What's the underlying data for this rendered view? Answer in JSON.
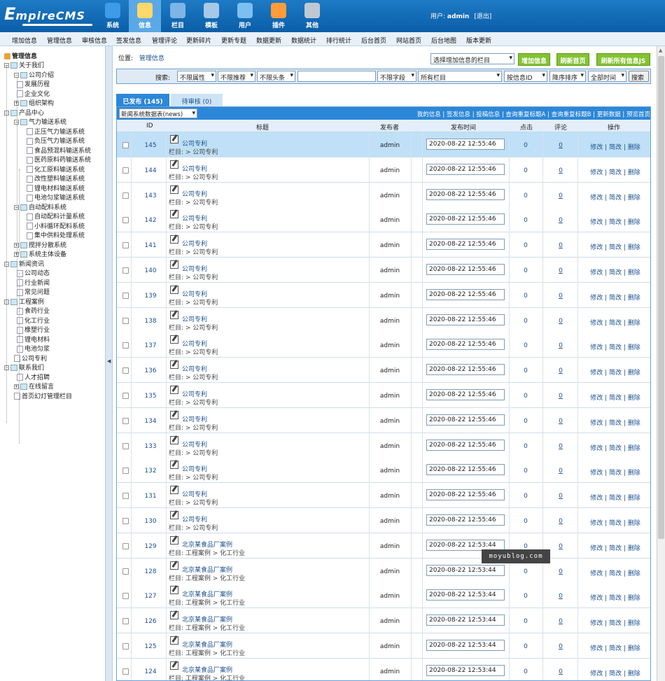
{
  "logo": {
    "first": "E",
    "rest": "mpireCMS"
  },
  "topnav": [
    {
      "label": "系统",
      "icon": "globe-icon"
    },
    {
      "label": "信息",
      "icon": "edit-icon"
    },
    {
      "label": "栏目",
      "icon": "folder-icon"
    },
    {
      "label": "模板",
      "icon": "template-icon"
    },
    {
      "label": "用户",
      "icon": "user-icon"
    },
    {
      "label": "插件",
      "icon": "tools-icon"
    },
    {
      "label": "其他",
      "icon": "gear-icon"
    }
  ],
  "user": {
    "prefix": "用户:",
    "name": "admin",
    "logout": "[退出]"
  },
  "menubar": [
    "增加信息",
    "管理信息",
    "审核信息",
    "签发信息",
    "管理评论",
    "更新碎片",
    "更新专题",
    "数据更新",
    "数据统计",
    "排行统计",
    "后台首页",
    "网站首页",
    "后台地图",
    "版本更新"
  ],
  "sidebar": {
    "title": "管理信息",
    "items": [
      {
        "label": "关于我们",
        "type": "folder",
        "level": 1
      },
      {
        "label": "公司介绍",
        "type": "folder",
        "level": 2
      },
      {
        "label": "发展历程",
        "type": "doc",
        "level": 3
      },
      {
        "label": "企业文化",
        "type": "doc",
        "level": 3
      },
      {
        "label": "组织架构",
        "type": "folder",
        "level": 2
      },
      {
        "label": "产品中心",
        "type": "folder",
        "level": 1
      },
      {
        "label": "气力输送系统",
        "type": "folder",
        "level": 2
      },
      {
        "label": "正压气力输送系统",
        "type": "doc",
        "level": 4
      },
      {
        "label": "负压气力输送系统",
        "type": "doc",
        "level": 4
      },
      {
        "label": "食品预混料输送系统",
        "type": "doc",
        "level": 4
      },
      {
        "label": "医药原料药输送系统",
        "type": "doc",
        "level": 4
      },
      {
        "label": "化工原料输送系统",
        "type": "doc",
        "level": 4
      },
      {
        "label": "改性塑料输送系统",
        "type": "doc",
        "level": 4
      },
      {
        "label": "锂电材料输送系统",
        "type": "doc",
        "level": 4
      },
      {
        "label": "电池匀浆输送系统",
        "type": "doc",
        "level": 4
      },
      {
        "label": "自动配料系统",
        "type": "folder",
        "level": 2
      },
      {
        "label": "自动配料计量系统",
        "type": "doc",
        "level": 4
      },
      {
        "label": "小料循环配料系统",
        "type": "doc",
        "level": 4
      },
      {
        "label": "集中供料处理系统",
        "type": "doc",
        "level": 4
      },
      {
        "label": "搅拌分散系统",
        "type": "folder",
        "level": 2
      },
      {
        "label": "系统主体设备",
        "type": "folder",
        "level": 2
      },
      {
        "label": "新闻资讯",
        "type": "folder",
        "level": 1
      },
      {
        "label": "公司动态",
        "type": "doc",
        "level": 3
      },
      {
        "label": "行业新闻",
        "type": "doc",
        "level": 3
      },
      {
        "label": "常见问题",
        "type": "doc",
        "level": 3
      },
      {
        "label": "工程案例",
        "type": "folder",
        "level": 1
      },
      {
        "label": "食药行业",
        "type": "doc",
        "level": 3
      },
      {
        "label": "化工行业",
        "type": "doc",
        "level": 3
      },
      {
        "label": "橡塑行业",
        "type": "doc",
        "level": 3
      },
      {
        "label": "锂电材料",
        "type": "doc",
        "level": 3
      },
      {
        "label": "电池匀浆",
        "type": "doc",
        "level": 3
      },
      {
        "label": "公司专利",
        "type": "doc",
        "level": 2
      },
      {
        "label": "联系我们",
        "type": "folder",
        "level": 1
      },
      {
        "label": "人才招聘",
        "type": "doc",
        "level": 3
      },
      {
        "label": "在线留言",
        "type": "folder",
        "level": 2
      },
      {
        "label": "首页幻灯管理栏目",
        "type": "doc",
        "level": 2
      }
    ]
  },
  "posbar": {
    "label": "位置:",
    "link": "管理信息"
  },
  "column_select": "选择增加信息的栏目",
  "buttons": {
    "add": "增加信息",
    "refresh": "刷新首页",
    "refresh_js": "刷新所有信息JS"
  },
  "search": {
    "label": "搜索:",
    "attr": "不限属性",
    "recommend": "不限推荐",
    "headline": "不限头条",
    "field": "不限字段",
    "column": "所有栏目",
    "order_by": "按信息ID",
    "order": "降序排序",
    "time": "全部时间",
    "submit": "搜索"
  },
  "tabs": {
    "published": "已发布 (145)",
    "pending": "待审核 (0)"
  },
  "table_module": "新闻系统数据表(news)",
  "header_links": "我的信息 | 签发信息 | 投稿信息 | 查询重复标题A | 查询重复标题B | 更新数据 | 预览首页",
  "columns": {
    "id": "ID",
    "title": "标题",
    "publisher": "发布者",
    "time": "发布时间",
    "clicks": "点击",
    "comments": "评论",
    "ops": "操作"
  },
  "rows": [
    {
      "id": "145",
      "title": "公司专利",
      "column": "栏目: > 公司专利",
      "publisher": "admin",
      "time": "2020-08-22 12:55:46",
      "clicks": "0",
      "comments": "0",
      "ops": "修改 | 简改 | 删除"
    },
    {
      "id": "144",
      "title": "公司专利",
      "column": "栏目: > 公司专利",
      "publisher": "admin",
      "time": "2020-08-22 12:55:46",
      "clicks": "0",
      "comments": "0",
      "ops": "修改 | 简改 | 删除"
    },
    {
      "id": "143",
      "title": "公司专利",
      "column": "栏目: > 公司专利",
      "publisher": "admin",
      "time": "2020-08-22 12:55:46",
      "clicks": "0",
      "comments": "0",
      "ops": "修改 | 简改 | 删除"
    },
    {
      "id": "142",
      "title": "公司专利",
      "column": "栏目: > 公司专利",
      "publisher": "admin",
      "time": "2020-08-22 12:55:46",
      "clicks": "0",
      "comments": "0",
      "ops": "修改 | 简改 | 删除"
    },
    {
      "id": "141",
      "title": "公司专利",
      "column": "栏目: > 公司专利",
      "publisher": "admin",
      "time": "2020-08-22 12:55:46",
      "clicks": "0",
      "comments": "0",
      "ops": "修改 | 简改 | 删除"
    },
    {
      "id": "140",
      "title": "公司专利",
      "column": "栏目: > 公司专利",
      "publisher": "admin",
      "time": "2020-08-22 12:55:46",
      "clicks": "0",
      "comments": "0",
      "ops": "修改 | 简改 | 删除"
    },
    {
      "id": "139",
      "title": "公司专利",
      "column": "栏目: > 公司专利",
      "publisher": "admin",
      "time": "2020-08-22 12:55:46",
      "clicks": "0",
      "comments": "0",
      "ops": "修改 | 简改 | 删除"
    },
    {
      "id": "138",
      "title": "公司专利",
      "column": "栏目: > 公司专利",
      "publisher": "admin",
      "time": "2020-08-22 12:55:46",
      "clicks": "0",
      "comments": "0",
      "ops": "修改 | 简改 | 删除"
    },
    {
      "id": "137",
      "title": "公司专利",
      "column": "栏目: > 公司专利",
      "publisher": "admin",
      "time": "2020-08-22 12:55:46",
      "clicks": "0",
      "comments": "0",
      "ops": "修改 | 简改 | 删除"
    },
    {
      "id": "136",
      "title": "公司专利",
      "column": "栏目: > 公司专利",
      "publisher": "admin",
      "time": "2020-08-22 12:55:46",
      "clicks": "0",
      "comments": "0",
      "ops": "修改 | 简改 | 删除"
    },
    {
      "id": "135",
      "title": "公司专利",
      "column": "栏目: > 公司专利",
      "publisher": "admin",
      "time": "2020-08-22 12:55:46",
      "clicks": "0",
      "comments": "0",
      "ops": "修改 | 简改 | 删除"
    },
    {
      "id": "134",
      "title": "公司专利",
      "column": "栏目: > 公司专利",
      "publisher": "admin",
      "time": "2020-08-22 12:55:46",
      "clicks": "0",
      "comments": "0",
      "ops": "修改 | 简改 | 删除"
    },
    {
      "id": "133",
      "title": "公司专利",
      "column": "栏目: > 公司专利",
      "publisher": "admin",
      "time": "2020-08-22 12:55:46",
      "clicks": "0",
      "comments": "0",
      "ops": "修改 | 简改 | 删除"
    },
    {
      "id": "132",
      "title": "公司专利",
      "column": "栏目: > 公司专利",
      "publisher": "admin",
      "time": "2020-08-22 12:55:46",
      "clicks": "0",
      "comments": "0",
      "ops": "修改 | 简改 | 删除"
    },
    {
      "id": "131",
      "title": "公司专利",
      "column": "栏目: > 公司专利",
      "publisher": "admin",
      "time": "2020-08-22 12:55:46",
      "clicks": "0",
      "comments": "0",
      "ops": "修改 | 简改 | 删除"
    },
    {
      "id": "130",
      "title": "公司专利",
      "column": "栏目: > 公司专利",
      "publisher": "admin",
      "time": "2020-08-22 12:55:46",
      "clicks": "0",
      "comments": "0",
      "ops": "修改 | 简改 | 删除"
    },
    {
      "id": "129",
      "title": "北京某食品厂案例",
      "column": "栏目: 工程案例 > 化工行业",
      "publisher": "admin",
      "time": "2020-08-22 12:53:44",
      "clicks": "0",
      "comments": "0",
      "ops": "修改 | 简改 | 删除"
    },
    {
      "id": "128",
      "title": "北京某食品厂案例",
      "column": "栏目: 工程案例 > 化工行业",
      "publisher": "admin",
      "time": "2020-08-22 12:53:44",
      "clicks": "0",
      "comments": "0",
      "ops": "修改 | 简改 | 删除"
    },
    {
      "id": "127",
      "title": "北京某食品厂案例",
      "column": "栏目: 工程案例 > 化工行业",
      "publisher": "admin",
      "time": "2020-08-22 12:53:44",
      "clicks": "0",
      "comments": "0",
      "ops": "修改 | 简改 | 删除"
    },
    {
      "id": "126",
      "title": "北京某食品厂案例",
      "column": "栏目: 工程案例 > 化工行业",
      "publisher": "admin",
      "time": "2020-08-22 12:53:44",
      "clicks": "0",
      "comments": "0",
      "ops": "修改 | 简改 | 删除"
    },
    {
      "id": "125",
      "title": "北京某食品厂案例",
      "column": "栏目: 工程案例 > 化工行业",
      "publisher": "admin",
      "time": "2020-08-22 12:53:44",
      "clicks": "0",
      "comments": "0",
      "ops": "修改 | 简改 | 删除"
    },
    {
      "id": "124",
      "title": "北京某食品厂案例",
      "column": "栏目: 工程案例 > 化工行业",
      "publisher": "admin",
      "time": "2020-08-22 12:53:44",
      "clicks": "0",
      "comments": "0",
      "ops": "修改 | 简改 | 删除"
    }
  ],
  "watermark": "moyublog.com",
  "colors": {
    "topbar": "#0b5ea8",
    "active_nav": "#5aa8e6",
    "green_btn": "#84c233",
    "tab_active": "#2c87d8",
    "row_highlight": "#bfe0f7"
  }
}
